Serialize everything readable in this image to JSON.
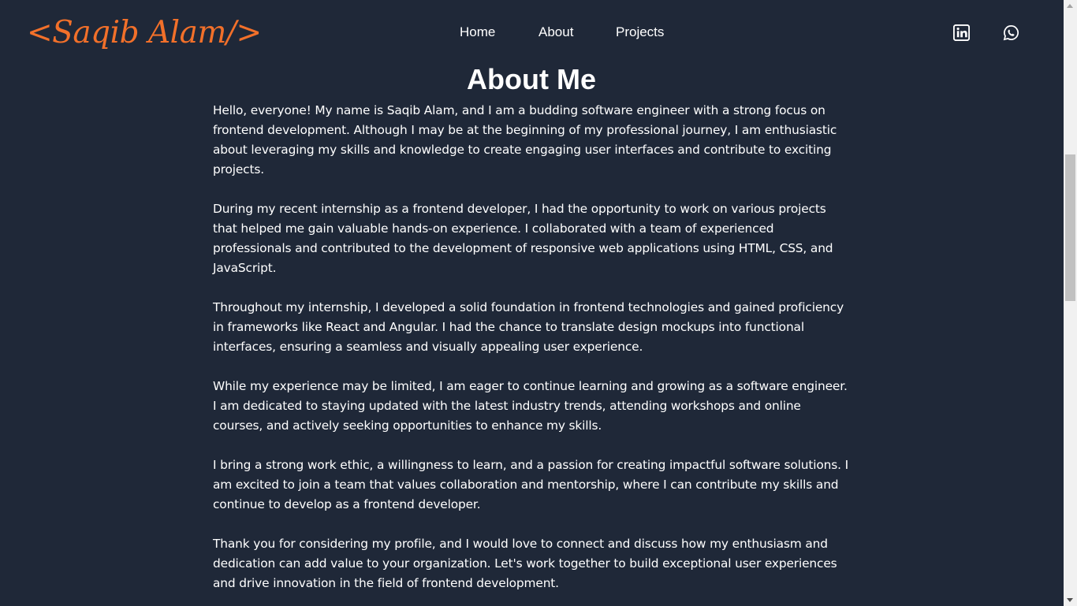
{
  "header": {
    "logo_text": "<Saqib Alam/>",
    "logo_color": "#f2702a",
    "nav": {
      "home": "Home",
      "about": "About",
      "projects": "Projects"
    },
    "social_icons": [
      "linkedin-icon",
      "whatsapp-icon"
    ]
  },
  "main": {
    "heading": "About Me",
    "paragraphs": [
      "Hello, everyone! My name is Saqib Alam, and I am a budding software engineer with a strong focus on frontend development. Although I may be at the beginning of my professional journey, I am enthusiastic about leveraging my skills and knowledge to create engaging user interfaces and contribute to exciting projects.",
      "During my recent internship as a frontend developer, I had the opportunity to work on various projects that helped me gain valuable hands-on experience. I collaborated with a team of experienced professionals and contributed to the development of responsive web applications using HTML, CSS, and JavaScript.",
      "Throughout my internship, I developed a solid foundation in frontend technologies and gained proficiency in frameworks like React and Angular. I had the chance to translate design mockups into functional interfaces, ensuring a seamless and visually appealing user experience.",
      "While my experience may be limited, I am eager to continue learning and growing as a software engineer. I am dedicated to staying updated with the latest industry trends, attending workshops and online courses, and actively seeking opportunities to enhance my skills.",
      "I bring a strong work ethic, a willingness to learn, and a passion for creating impactful software solutions. I am excited to join a team that values collaboration and mentorship, where I can contribute my skills and continue to develop as a frontend developer.",
      "Thank you for considering my profile, and I would love to connect and discuss how my enthusiasm and dedication can add value to your organization. Let's work together to build exceptional user experiences and drive innovation in the field of frontend development."
    ]
  },
  "colors": {
    "background": "#1f2838",
    "text": "#ffffff",
    "accent": "#f2702a"
  }
}
